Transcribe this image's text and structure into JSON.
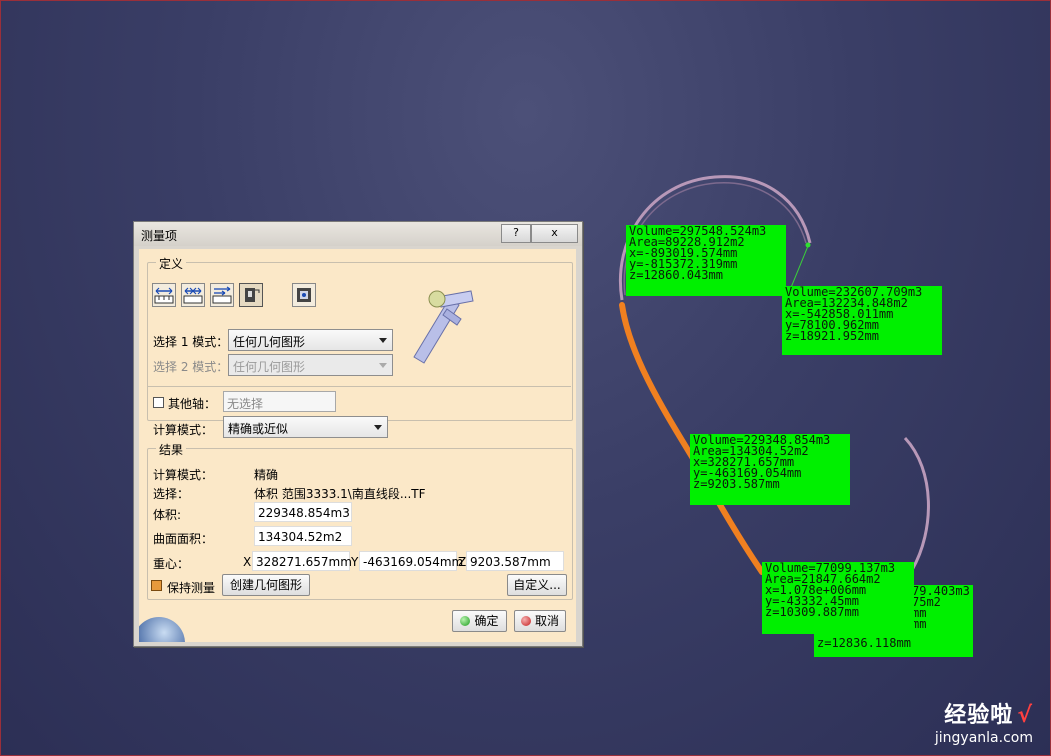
{
  "dialog": {
    "title": "测量项",
    "help_label": "?",
    "close_label": "x",
    "definition": {
      "group_label": "定义",
      "select1_label": "选择 1 模式：",
      "select1_value": "任何几何图形",
      "select2_label": "选择 2 模式：",
      "select2_value": "任何几何图形",
      "other_axis_label": "其他轴：",
      "other_axis_value": "无选择",
      "calc_mode_label": "计算模式：",
      "calc_mode_value": "精确或近似"
    },
    "results": {
      "group_label": "结果",
      "calc_mode_label": "计算模式：",
      "calc_mode_value": "精确",
      "selection_label": "选择：",
      "selection_value": "体积 范围3333.1\\南直线段...TF",
      "volume_label": "体积:",
      "volume_value": "229348.854m3",
      "area_label": "曲面面积：",
      "area_value": "134304.52m2",
      "cog_label": "重心：",
      "x_label": "X",
      "x_value": "328271.657mm",
      "y_label": "Y",
      "y_value": "-463169.054mm",
      "z_label": "Z",
      "z_value": "9203.587mm"
    },
    "keep_measure_label": "保持测量",
    "create_geometry_label": "创建几何图形",
    "customize_label": "自定义...",
    "ok_label": "确定",
    "cancel_label": "取消"
  },
  "annotations": [
    {
      "lines": [
        "Volume=297548.524m3",
        "Area=89228.912m2",
        "x=-893019.574mm",
        "y=-815372.319mm",
        "z=12860.043mm"
      ]
    },
    {
      "lines": [
        "Volume=232607.709m3",
        "Area=132234.848m2",
        "x=-542858.011mm",
        "y=78100.962mm",
        "z=18921.952mm"
      ]
    },
    {
      "lines": [
        "Volume=229348.854m3",
        "Area=134304.52m2",
        "x=328271.657mm",
        "y=-463169.054mm",
        "z=9203.587mm"
      ]
    },
    {
      "lines": [
        "Volume=77099.137m3",
        "Area=21847.664m2",
        "x=1.078e+006mm",
        "y=-43332.45mm",
        "z=10309.887mm"
      ]
    },
    {
      "lines": [
        "79.403m3",
        "75m2",
        "mm",
        "mm",
        "z=12836.118mm"
      ]
    }
  ],
  "watermark": {
    "title": "经验啦",
    "check": "√",
    "url": "jingyanla.com"
  },
  "colors": {
    "highlight_box": "#00f000",
    "selected_curve": "#f08020",
    "curve": "#b08ab0",
    "dialog_bg": "#fbe8c8"
  }
}
